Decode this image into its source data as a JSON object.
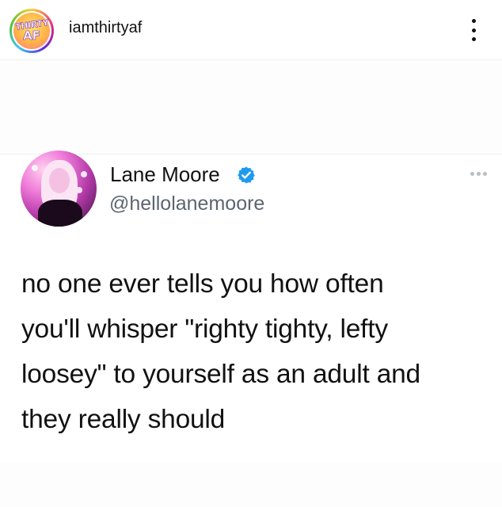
{
  "post_header": {
    "avatar_logo_line1": "THIRTY",
    "avatar_logo_line2": "AF",
    "username": "iamthirtyaf",
    "more_icon": "more-vertical-icon"
  },
  "tweet": {
    "display_name": "Lane Moore",
    "verified_icon": "verified-badge-icon",
    "handle": "@hellolanemoore",
    "more_icon": "more-horizontal-icon",
    "text_lines": [
      "no one ever tells you how often",
      "you'll whisper \"righty tighty, lefty",
      "loosey\" to yourself as an adult and",
      "they really should"
    ]
  },
  "colors": {
    "verified_blue": "#1d9bf0",
    "handle_gray": "#5b6570",
    "divider": "#efefef"
  }
}
